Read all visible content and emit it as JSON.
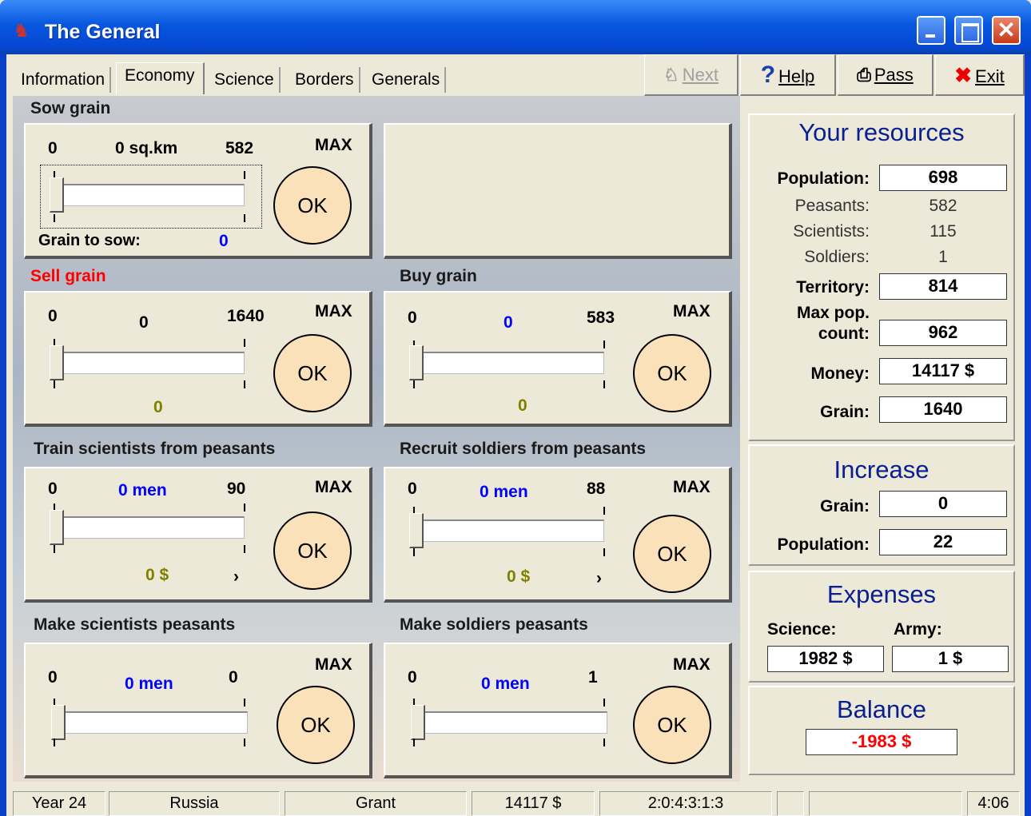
{
  "window": {
    "title": "The General",
    "app_icon": "soldier-icon"
  },
  "tabs": [
    "Information",
    "Economy",
    "Science",
    "Borders",
    "Generals"
  ],
  "toolbar": {
    "next": {
      "label": "Next",
      "icon": "walking-man-icon"
    },
    "help": {
      "label": "Help",
      "icon": "question-mark-icon"
    },
    "pass": {
      "label": "Pass",
      "icon": "printer-icon"
    },
    "exit": {
      "label": "Exit",
      "icon": "red-x-icon"
    }
  },
  "panels": {
    "sow": {
      "heading": "Sow grain",
      "min": "0",
      "value": "0 sq.km",
      "max": "582",
      "max_label": "MAX",
      "ok": "OK",
      "bottom_label": "Grain to sow:",
      "bottom_value": "0"
    },
    "sell": {
      "heading": "Sell grain",
      "min": "0",
      "value": "0",
      "max": "1640",
      "max_label": "MAX",
      "ok": "OK",
      "bottom_value": "0"
    },
    "buy": {
      "heading": "Buy grain",
      "min": "0",
      "value": "0",
      "max": "583",
      "max_label": "MAX",
      "ok": "OK",
      "bottom_value": "0"
    },
    "train": {
      "heading": "Train scientists from peasants",
      "min": "0",
      "value": "0 men",
      "max": "90",
      "max_label": "MAX",
      "ok": "OK",
      "cost": "0 $",
      "arrow": "›"
    },
    "recruit": {
      "heading": "Recruit soldiers from peasants",
      "min": "0",
      "value": "0 men",
      "max": "88",
      "max_label": "MAX",
      "ok": "OK",
      "cost": "0 $",
      "arrow": "›"
    },
    "sci_peas": {
      "heading": "Make scientists peasants",
      "min": "0",
      "value": "0 men",
      "max": "0",
      "max_label": "MAX",
      "ok": "OK"
    },
    "sol_peas": {
      "heading": "Make soldiers peasants",
      "min": "0",
      "value": "0 men",
      "max": "1",
      "max_label": "MAX",
      "ok": "OK"
    }
  },
  "resources": {
    "title": "Your resources",
    "population_label": "Population:",
    "population": "698",
    "peasants_label": "Peasants:",
    "peasants": "582",
    "scientists_label": "Scientists:",
    "scientists": "115",
    "soldiers_label": "Soldiers:",
    "soldiers": "1",
    "territory_label": "Territory:",
    "territory": "814",
    "maxpop_label_1": "Max pop.",
    "maxpop_label_2": "count:",
    "maxpop": "962",
    "money_label": "Money:",
    "money": "14117 $",
    "grain_label": "Grain:",
    "grain": "1640"
  },
  "increase": {
    "title": "Increase",
    "grain_label": "Grain:",
    "grain": "0",
    "population_label": "Population:",
    "population": "22"
  },
  "expenses": {
    "title": "Expenses",
    "science_label": "Science:",
    "science": "1982 $",
    "army_label": "Army:",
    "army": "1 $"
  },
  "balance": {
    "title": "Balance",
    "value": "-1983 $",
    "color": "#ff0000"
  },
  "statusbar": [
    "Year 24",
    "Russia",
    "Grant",
    "14117 $",
    "2:0:4:3:1:3",
    "",
    "",
    "4:06"
  ]
}
